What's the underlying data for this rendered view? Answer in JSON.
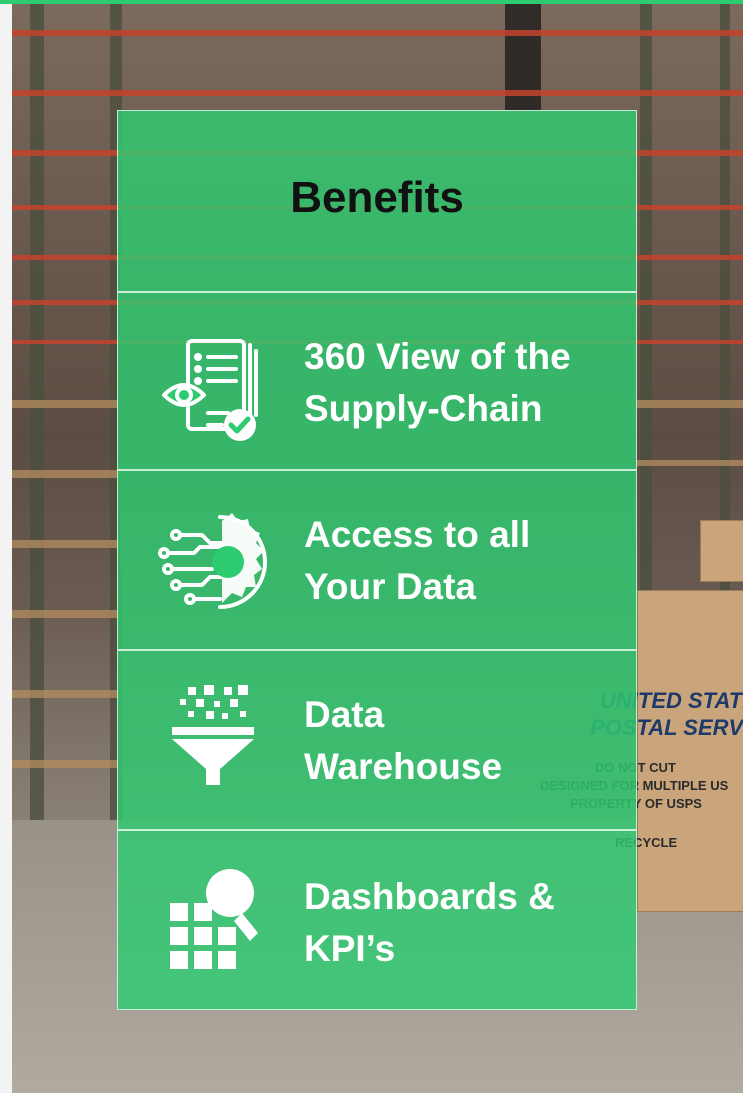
{
  "panel": {
    "title": "Benefits",
    "items": [
      {
        "label": "360 View of the\nSupply-Chain",
        "icon": "checklist-eye-icon"
      },
      {
        "label": "Access to all\nYour Data",
        "icon": "circuit-gear-icon"
      },
      {
        "label": "Data\nWarehouse",
        "icon": "funnel-icon"
      },
      {
        "label": "Dashboards &\nKPI’s",
        "icon": "dashboard-search-icon"
      }
    ]
  },
  "background": {
    "box_text": {
      "line1": "UNITED STATES",
      "line2": "POSTAL SERVICE",
      "line3": "DO NOT CUT",
      "line4": "DESIGNED FOR MULTIPLE US",
      "line5": "PROPERTY OF USPS",
      "line6": "RECYCLE"
    }
  },
  "colors": {
    "accent": "#2ecc71",
    "title_text": "#111111",
    "item_text": "#ffffff"
  }
}
